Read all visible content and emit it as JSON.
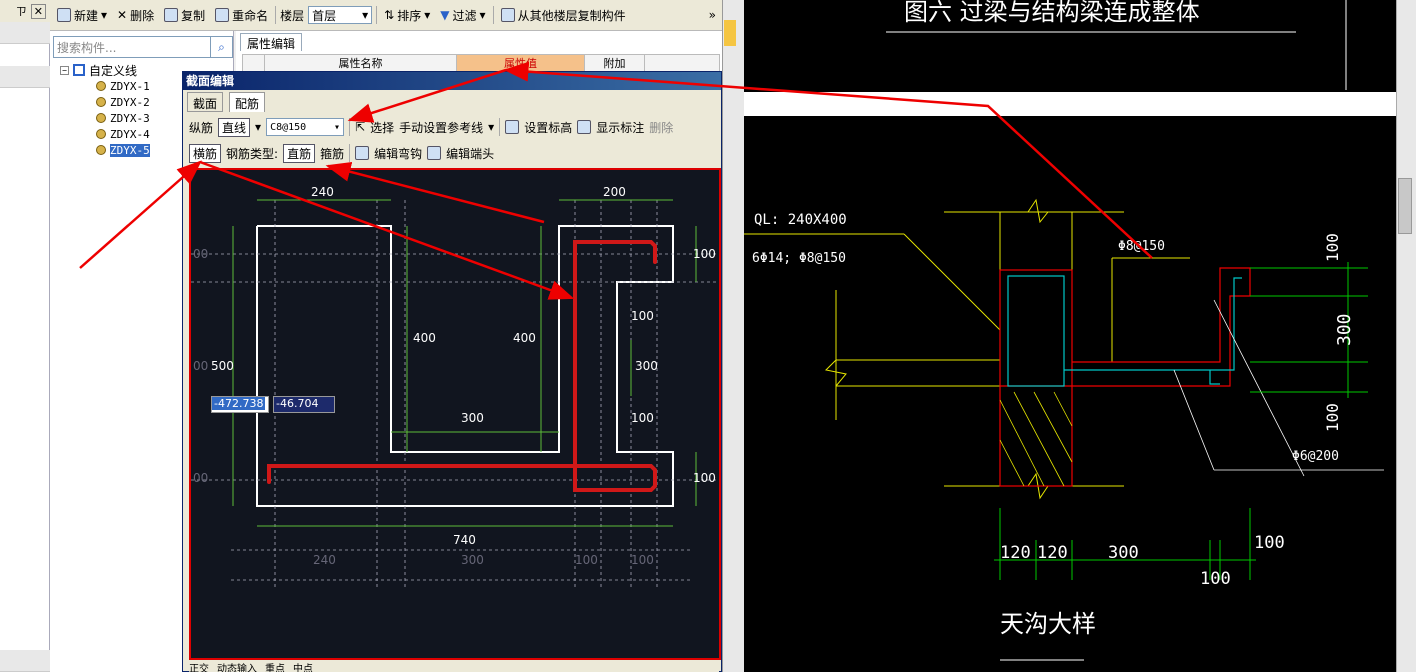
{
  "pinbar": {
    "pin": "ㄗ",
    "close": "✕"
  },
  "toolbar": {
    "new_label": "新建",
    "delete_label": "删除",
    "copy_label": "复制",
    "rename_label": "重命名",
    "floor_label": "楼层",
    "floor_value": "首层",
    "sort_label": "排序",
    "filter_label": "过滤",
    "copy_from_floor_label": "从其他楼层复制构件",
    "more": "»"
  },
  "search": {
    "placeholder": "搜索构件..."
  },
  "tree": {
    "root": "自定义线",
    "items": [
      "ZDYX-1",
      "ZDYX-2",
      "ZDYX-3",
      "ZDYX-4",
      "ZDYX-5"
    ],
    "selected_index": 4
  },
  "props": {
    "tab_label": "属性编辑",
    "columns": [
      "",
      "属性名称",
      "属性值",
      "附加"
    ]
  },
  "dialog": {
    "title": "截面编辑",
    "tabs": [
      "截面",
      "配筋"
    ],
    "active_tab": 1,
    "row1": {
      "longitudinal": "纵筋",
      "straight": "直线",
      "rebar_value": "C8@150",
      "select": "选择",
      "manual_ref": "手动设置参考线",
      "set_elev": "设置标高",
      "show_label": "显示标注",
      "delete": "删除"
    },
    "row2": {
      "transverse": "横筋",
      "rebar_type": "钢筋类型:",
      "straight": "直筋",
      "stirrup": "箍筋",
      "edit_hook": "编辑弯钩",
      "edit_end": "编辑端头"
    },
    "coord_x": "-472.738",
    "coord_y": "-46.704",
    "status": [
      "正交",
      "动态输入",
      "重点",
      "中点"
    ]
  },
  "drawing": {
    "dims": {
      "d240": "240",
      "d200": "200",
      "d100a": "100",
      "d400a": "400",
      "d400b": "400",
      "d500": "500",
      "d300a": "300",
      "d100b": "100",
      "d300b": "300",
      "d100c": "100",
      "d100d": "100",
      "d740": "740",
      "b240": "240",
      "b300": "300",
      "b100a": "100",
      "b100b": "100",
      "l00a": "00",
      "l00b": "00",
      "l00c": "00"
    }
  },
  "cad": {
    "title": "图六 过梁与结构梁连成整体",
    "ql": "QL: 240X400",
    "rebar_note": "6Φ14; Φ8@150",
    "phi8": "Φ8@150",
    "phi6": "Φ6@200",
    "v100a": "100",
    "v300": "300",
    "v100b": "100",
    "b120a": "120",
    "b120b": "120",
    "b300": "300",
    "b100a": "100",
    "b100b": "100",
    "caption": "天沟大样"
  }
}
